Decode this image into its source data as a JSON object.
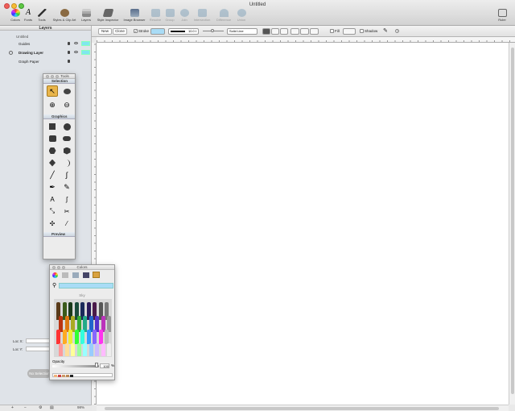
{
  "window": {
    "title": "Untitled"
  },
  "toolbar": {
    "items": [
      {
        "label": "Colors",
        "icon": "color-wheel-icon",
        "enabled": true
      },
      {
        "label": "Fonts",
        "icon": "font-icon",
        "enabled": true
      },
      {
        "label": "Tools",
        "icon": "tools-icon",
        "enabled": true
      },
      {
        "label": "Styles & Clip Art",
        "icon": "palette-icon",
        "enabled": true
      },
      {
        "label": "Layers",
        "icon": "layers-icon",
        "enabled": true
      },
      {
        "label": "Style Inspector",
        "icon": "style-inspector-icon",
        "enabled": true
      },
      {
        "label": "Image Browser",
        "icon": "image-browser-icon",
        "enabled": true
      },
      {
        "label": "Resolve",
        "icon": "resolve-icon",
        "enabled": false
      },
      {
        "label": "Group",
        "icon": "group-icon",
        "enabled": false
      },
      {
        "label": "Join",
        "icon": "join-icon",
        "enabled": false
      },
      {
        "label": "Intersection",
        "icon": "intersection-icon",
        "enabled": false
      },
      {
        "label": "Difference",
        "icon": "difference-icon",
        "enabled": false
      },
      {
        "label": "Union",
        "icon": "union-icon",
        "enabled": false
      }
    ],
    "right_item": {
      "label": "Ruler",
      "icon": "ruler-icon"
    }
  },
  "layers_panel": {
    "header": "Layers",
    "document": "Untitled",
    "layers": [
      {
        "name": "Guides",
        "selected": false
      },
      {
        "name": "Drawing Layer",
        "selected": true
      },
      {
        "name": "Graph Paper",
        "selected": false
      }
    ]
  },
  "context_bar": {
    "new_label": "New",
    "clone_label": "Clone",
    "stroke_label": "Stroke",
    "stroke_width": "10.0 t",
    "line_style": "Solid Line",
    "fill_label": "Fill",
    "shadow_label": "Shadow",
    "stroke_color": "#a9dcf6"
  },
  "location": {
    "loc_x_label": "Loc X:",
    "loc_y_label": "Loc Y:",
    "no_selection": "No Selection"
  },
  "status": {
    "zoom": "98%"
  },
  "tools_panel": {
    "title": "Tools",
    "sections": [
      "Selection",
      "Graphics",
      "Preview"
    ]
  },
  "colors_panel": {
    "title": "Colors",
    "color_name": "Sky",
    "opacity_label": "Opacity",
    "opacity_value": "100",
    "opacity_unit": "%",
    "selected_color": "#a9dcf6"
  },
  "accent": {
    "sidebar_swatch": "#7fe7ef"
  }
}
